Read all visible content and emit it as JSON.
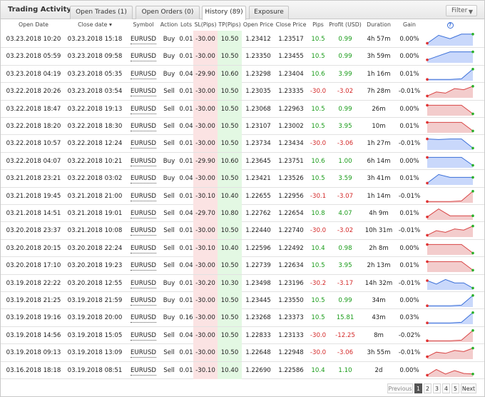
{
  "title": "Trading Activity",
  "tabs": [
    {
      "label": "Open Trades (1)",
      "active": false
    },
    {
      "label": "Open Orders (0)",
      "active": false
    },
    {
      "label": "History (89)",
      "active": true
    },
    {
      "label": "Exposure",
      "active": false
    }
  ],
  "filter_label": "Filter",
  "columns": {
    "open_date": "Open Date",
    "close_date": "Close date",
    "symbol": "Symbol",
    "action": "Action",
    "lots": "Lots",
    "sl": "SL(Pips)",
    "tp": "TP(Pips)",
    "open_price": "Open Price",
    "close_price": "Close Price",
    "pips": "Pips",
    "profit": "Profit (USD)",
    "duration": "Duration",
    "gain": "Gain",
    "info": "?"
  },
  "colors": {
    "positive": "#1a9c1a",
    "negative": "#d42a2a",
    "sl_bg": "#fbe3e3",
    "tp_bg": "#e3f8e3",
    "spark_blue_fill": "#c9d8fb",
    "spark_blue_line": "#3a6fd8",
    "spark_red_fill": "#f3cccc",
    "spark_red_line": "#d84545"
  },
  "rows": [
    {
      "open": "03.23.2018 10:20",
      "close": "03.23.2018 15:18",
      "symbol": "EURUSD",
      "action": "Buy",
      "lots": "0.01",
      "sl": "-30.00",
      "tp": "10.50",
      "op": "1.23412",
      "cp": "1.23517",
      "pips": "10.5",
      "profit": "0.99",
      "duration": "4h 57m",
      "gain": "0.00%",
      "win": true,
      "spark": [
        0.15,
        0.85,
        0.55,
        0.95,
        0.95
      ]
    },
    {
      "open": "03.23.2018 05:59",
      "close": "03.23.2018 09:58",
      "symbol": "EURUSD",
      "action": "Buy",
      "lots": "0.01",
      "sl": "-30.00",
      "tp": "10.50",
      "op": "1.23350",
      "cp": "1.23455",
      "pips": "10.5",
      "profit": "0.99",
      "duration": "3h 59m",
      "gain": "0.00%",
      "win": true,
      "spark": [
        0.2,
        0.55,
        0.9,
        0.9,
        0.9
      ]
    },
    {
      "open": "03.23.2018 04:19",
      "close": "03.23.2018 05:35",
      "symbol": "EURUSD",
      "action": "Buy",
      "lots": "0.04",
      "sl": "-29.90",
      "tp": "10.60",
      "op": "1.23298",
      "cp": "1.23404",
      "pips": "10.6",
      "profit": "3.99",
      "duration": "1h 16m",
      "gain": "0.01%",
      "win": true,
      "spark": [
        0.05,
        0.05,
        0.05,
        0.1,
        0.95
      ]
    },
    {
      "open": "03.22.2018 20:26",
      "close": "03.23.2018 03:54",
      "symbol": "EURUSD",
      "action": "Sell",
      "lots": "0.01",
      "sl": "-30.00",
      "tp": "10.50",
      "op": "1.23035",
      "cp": "1.23335",
      "pips": "-30.0",
      "profit": "-3.02",
      "duration": "7h 28m",
      "gain": "-0.01%",
      "win": false,
      "spark": [
        0.1,
        0.45,
        0.35,
        0.75,
        0.65,
        0.95
      ]
    },
    {
      "open": "03.22.2018 18:47",
      "close": "03.22.2018 19:13",
      "symbol": "EURUSD",
      "action": "Sell",
      "lots": "0.01",
      "sl": "-30.00",
      "tp": "10.50",
      "op": "1.23068",
      "cp": "1.22963",
      "pips": "10.5",
      "profit": "0.99",
      "duration": "26m",
      "gain": "0.00%",
      "win": false,
      "spark": [
        0.85,
        0.85,
        0.85,
        0.85,
        0.1
      ]
    },
    {
      "open": "03.22.2018 18:20",
      "close": "03.22.2018 18:30",
      "symbol": "EURUSD",
      "action": "Sell",
      "lots": "0.04",
      "sl": "-30.00",
      "tp": "10.50",
      "op": "1.23107",
      "cp": "1.23002",
      "pips": "10.5",
      "profit": "3.95",
      "duration": "10m",
      "gain": "0.01%",
      "win": false,
      "spark": [
        0.85,
        0.85,
        0.85,
        0.85,
        0.1
      ]
    },
    {
      "open": "03.22.2018 10:57",
      "close": "03.22.2018 12:24",
      "symbol": "EURUSD",
      "action": "Sell",
      "lots": "0.01",
      "sl": "-30.00",
      "tp": "10.50",
      "op": "1.23734",
      "cp": "1.23434",
      "pips": "-30.0",
      "profit": "-3.06",
      "duration": "1h 27m",
      "gain": "-0.01%",
      "win": true,
      "spark": [
        0.9,
        0.85,
        0.9,
        0.9,
        0.1
      ]
    },
    {
      "open": "03.22.2018 04:07",
      "close": "03.22.2018 10:21",
      "symbol": "EURUSD",
      "action": "Buy",
      "lots": "0.01",
      "sl": "-29.90",
      "tp": "10.60",
      "op": "1.23645",
      "cp": "1.23751",
      "pips": "10.6",
      "profit": "1.00",
      "duration": "6h 14m",
      "gain": "0.00%",
      "win": true,
      "spark": [
        0.85,
        0.85,
        0.85,
        0.85,
        0.15
      ]
    },
    {
      "open": "03.21.2018 23:21",
      "close": "03.22.2018 03:02",
      "symbol": "EURUSD",
      "action": "Buy",
      "lots": "0.04",
      "sl": "-30.00",
      "tp": "10.50",
      "op": "1.23421",
      "cp": "1.23526",
      "pips": "10.5",
      "profit": "3.59",
      "duration": "3h 41m",
      "gain": "0.01%",
      "win": true,
      "spark": [
        0.1,
        0.85,
        0.6,
        0.6,
        0.6
      ]
    },
    {
      "open": "03.21.2018 19:45",
      "close": "03.21.2018 21:00",
      "symbol": "EURUSD",
      "action": "Sell",
      "lots": "0.01",
      "sl": "-30.10",
      "tp": "10.40",
      "op": "1.22655",
      "cp": "1.22956",
      "pips": "-30.1",
      "profit": "-3.07",
      "duration": "1h 14m",
      "gain": "-0.01%",
      "win": false,
      "spark": [
        0.05,
        0.05,
        0.05,
        0.1,
        0.95
      ]
    },
    {
      "open": "03.21.2018 14:51",
      "close": "03.21.2018 19:01",
      "symbol": "EURUSD",
      "action": "Sell",
      "lots": "0.04",
      "sl": "-29.70",
      "tp": "10.80",
      "op": "1.22762",
      "cp": "1.22654",
      "pips": "10.8",
      "profit": "4.07",
      "duration": "4h 9m",
      "gain": "0.01%",
      "win": false,
      "spark": [
        0.2,
        0.9,
        0.3,
        0.3,
        0.3
      ]
    },
    {
      "open": "03.20.2018 23:37",
      "close": "03.21.2018 10:08",
      "symbol": "EURUSD",
      "action": "Sell",
      "lots": "0.01",
      "sl": "-30.00",
      "tp": "10.50",
      "op": "1.22440",
      "cp": "1.22740",
      "pips": "-30.0",
      "profit": "-3.02",
      "duration": "10h 31m",
      "gain": "-0.01%",
      "win": false,
      "spark": [
        0.1,
        0.5,
        0.35,
        0.65,
        0.55,
        0.9
      ]
    },
    {
      "open": "03.20.2018 20:15",
      "close": "03.20.2018 22:24",
      "symbol": "EURUSD",
      "action": "Sell",
      "lots": "0.01",
      "sl": "-30.10",
      "tp": "10.40",
      "op": "1.22596",
      "cp": "1.22492",
      "pips": "10.4",
      "profit": "0.98",
      "duration": "2h 8m",
      "gain": "0.00%",
      "win": false,
      "spark": [
        0.85,
        0.85,
        0.85,
        0.85,
        0.1
      ]
    },
    {
      "open": "03.20.2018 17:10",
      "close": "03.20.2018 19:23",
      "symbol": "EURUSD",
      "action": "Sell",
      "lots": "0.04",
      "sl": "-30.00",
      "tp": "10.50",
      "op": "1.22739",
      "cp": "1.22634",
      "pips": "10.5",
      "profit": "3.95",
      "duration": "2h 13m",
      "gain": "0.01%",
      "win": false,
      "spark": [
        0.85,
        0.85,
        0.85,
        0.85,
        0.1
      ]
    },
    {
      "open": "03.19.2018 22:22",
      "close": "03.20.2018 12:55",
      "symbol": "EURUSD",
      "action": "Buy",
      "lots": "0.01",
      "sl": "-30.20",
      "tp": "10.30",
      "op": "1.23498",
      "cp": "1.23196",
      "pips": "-30.2",
      "profit": "-3.17",
      "duration": "14h 32m",
      "gain": "-0.01%",
      "win": true,
      "spark": [
        0.75,
        0.45,
        0.85,
        0.55,
        0.55,
        0.1
      ]
    },
    {
      "open": "03.19.2018 21:25",
      "close": "03.19.2018 21:59",
      "symbol": "EURUSD",
      "action": "Buy",
      "lots": "0.01",
      "sl": "-30.00",
      "tp": "10.50",
      "op": "1.23445",
      "cp": "1.23550",
      "pips": "10.5",
      "profit": "0.99",
      "duration": "34m",
      "gain": "0.00%",
      "win": true,
      "spark": [
        0.05,
        0.05,
        0.05,
        0.1,
        0.95
      ]
    },
    {
      "open": "03.19.2018 19:16",
      "close": "03.19.2018 20:00",
      "symbol": "EURUSD",
      "action": "Buy",
      "lots": "0.16",
      "sl": "-30.00",
      "tp": "10.50",
      "op": "1.23268",
      "cp": "1.23373",
      "pips": "10.5",
      "profit": "15.81",
      "duration": "43m",
      "gain": "0.03%",
      "win": true,
      "spark": [
        0.05,
        0.05,
        0.05,
        0.1,
        0.95
      ]
    },
    {
      "open": "03.19.2018 14:56",
      "close": "03.19.2018 15:05",
      "symbol": "EURUSD",
      "action": "Sell",
      "lots": "0.04",
      "sl": "-30.00",
      "tp": "10.50",
      "op": "1.22833",
      "cp": "1.23133",
      "pips": "-30.0",
      "profit": "-12.25",
      "duration": "8m",
      "gain": "-0.02%",
      "win": false,
      "spark": [
        0.05,
        0.05,
        0.05,
        0.1,
        0.95
      ]
    },
    {
      "open": "03.19.2018 09:13",
      "close": "03.19.2018 13:09",
      "symbol": "EURUSD",
      "action": "Sell",
      "lots": "0.01",
      "sl": "-30.00",
      "tp": "10.50",
      "op": "1.22648",
      "cp": "1.22948",
      "pips": "-30.0",
      "profit": "-3.06",
      "duration": "3h 55m",
      "gain": "-0.01%",
      "win": false,
      "spark": [
        0.15,
        0.55,
        0.45,
        0.7,
        0.6,
        0.9
      ]
    },
    {
      "open": "03.16.2018 18:18",
      "close": "03.19.2018 08:51",
      "symbol": "EURUSD",
      "action": "Sell",
      "lots": "0.01",
      "sl": "-30.10",
      "tp": "10.40",
      "op": "1.22690",
      "cp": "1.22586",
      "pips": "10.4",
      "profit": "1.10",
      "duration": "2d",
      "gain": "0.00%",
      "win": false,
      "spark": [
        0.1,
        0.6,
        0.2,
        0.5,
        0.25,
        0.2
      ]
    }
  ],
  "pagination": {
    "prev": "Previous",
    "pages": [
      "1",
      "2",
      "3",
      "4",
      "5"
    ],
    "current": "1",
    "next": "Next"
  }
}
